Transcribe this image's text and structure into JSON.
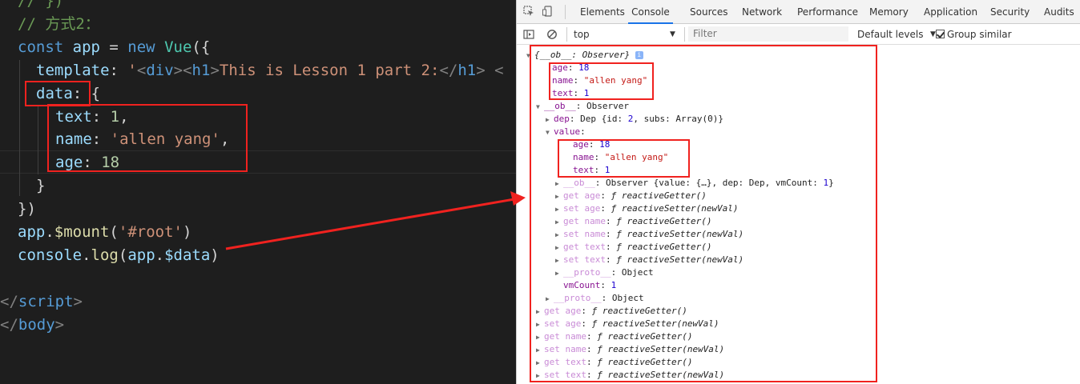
{
  "editor": {
    "lines": [
      {
        "parts": [
          [
            "// })",
            "com"
          ]
        ]
      },
      {
        "parts": [
          [
            "// 方式2：",
            "com"
          ]
        ]
      },
      {
        "parts": [
          [
            "const ",
            "kw"
          ],
          [
            "app",
            "var"
          ],
          [
            " = ",
            "pun"
          ],
          [
            "new ",
            "kw"
          ],
          [
            "Vue",
            "cls"
          ],
          [
            "({",
            "pun"
          ]
        ]
      },
      {
        "parts": [
          [
            "template",
            "var"
          ],
          [
            ": ",
            "pun"
          ],
          [
            "'",
            "str"
          ],
          [
            "<",
            "tag"
          ],
          [
            "div",
            "tagname"
          ],
          [
            ">",
            "tag"
          ],
          [
            "<",
            "tag"
          ],
          [
            "h1",
            "tagname"
          ],
          [
            ">",
            "tag"
          ],
          [
            "This is Lesson 1 part 2:",
            "str"
          ],
          [
            "</",
            "tag"
          ],
          [
            "h1",
            "tagname"
          ],
          [
            ">",
            "tag"
          ],
          [
            " <",
            "tag"
          ]
        ]
      },
      {
        "parts": [
          [
            "data",
            "var"
          ],
          [
            ": {",
            "pun"
          ]
        ]
      },
      {
        "parts": [
          [
            "text",
            "var"
          ],
          [
            ": ",
            "pun"
          ],
          [
            "1",
            "num"
          ],
          [
            ",",
            "pun"
          ]
        ]
      },
      {
        "parts": [
          [
            "name",
            "var"
          ],
          [
            ": ",
            "pun"
          ],
          [
            "'allen yang'",
            "str"
          ],
          [
            ",",
            "pun"
          ]
        ]
      },
      {
        "parts": [
          [
            "age",
            "var"
          ],
          [
            ": ",
            "pun"
          ],
          [
            "18",
            "num"
          ]
        ]
      },
      {
        "parts": [
          [
            "}",
            "pun"
          ]
        ]
      },
      {
        "parts": [
          [
            "})",
            "pun"
          ]
        ]
      },
      {
        "parts": [
          [
            "app",
            "var"
          ],
          [
            ".",
            "pun"
          ],
          [
            "$mount",
            "fn"
          ],
          [
            "(",
            "pun"
          ],
          [
            "'#root'",
            "str"
          ],
          [
            ")",
            "pun"
          ]
        ]
      },
      {
        "parts": [
          [
            "console",
            "var"
          ],
          [
            ".",
            "pun"
          ],
          [
            "log",
            "fn"
          ],
          [
            "(",
            "pun"
          ],
          [
            "app",
            "var"
          ],
          [
            ".",
            "pun"
          ],
          [
            "$data",
            "var"
          ],
          [
            ")",
            "pun"
          ]
        ]
      },
      {
        "parts": []
      },
      {
        "parts": [
          [
            "</",
            "tag"
          ],
          [
            "script",
            "tagname"
          ],
          [
            ">",
            "tag"
          ]
        ]
      },
      {
        "parts": [
          [
            "</",
            "tag"
          ],
          [
            "body",
            "tagname"
          ],
          [
            ">",
            "tag"
          ]
        ]
      }
    ]
  },
  "devtools": {
    "tabs": [
      "Elements",
      "Console",
      "Sources",
      "Network",
      "Performance",
      "Memory",
      "Application",
      "Security",
      "Audits"
    ],
    "active_tab": "Console",
    "context": "top",
    "filter_placeholder": "Filter",
    "levels": "Default levels",
    "group_similar": "Group similar",
    "accent_color": "#1a73e8"
  },
  "console": {
    "rows": [
      {
        "tri": "▼",
        "html": "<span class='i'>{__ob__: Observer}</span> <span class='info'>i</span>"
      },
      {
        "tri": "",
        "html": "<span class='k'>age</span>: <span class='n'>18</span>"
      },
      {
        "tri": "",
        "html": "<span class='k'>name</span>: <span class='s'>\"allen yang\"</span>"
      },
      {
        "tri": "",
        "html": "<span class='k'>text</span>: <span class='n'>1</span>"
      },
      {
        "tri": "▼",
        "html": "<span class='k'>__ob__</span>: Observer"
      },
      {
        "tri": "▶",
        "html": "<span class='k'>dep</span>: Dep {id: <span class='n'>2</span>, subs: Array(0)}"
      },
      {
        "tri": "▼",
        "html": "<span class='k'>value</span>:"
      },
      {
        "tri": "",
        "html": "<span class='k'>age</span>: <span class='n'>18</span>"
      },
      {
        "tri": "",
        "html": "<span class='k'>name</span>: <span class='s'>\"allen yang\"</span>"
      },
      {
        "tri": "",
        "html": "<span class='k'>text</span>: <span class='n'>1</span>"
      },
      {
        "tri": "▶",
        "html": "<span class='kd'>__ob__</span>: Observer {value: {…}, dep: Dep, vmCount: <span class='n'>1</span>}"
      },
      {
        "tri": "▶",
        "html": "<span class='kd'>get age</span>: <span class='i'>ƒ reactiveGetter()</span>"
      },
      {
        "tri": "▶",
        "html": "<span class='kd'>set age</span>: <span class='i'>ƒ reactiveSetter(newVal)</span>"
      },
      {
        "tri": "▶",
        "html": "<span class='kd'>get name</span>: <span class='i'>ƒ reactiveGetter()</span>"
      },
      {
        "tri": "▶",
        "html": "<span class='kd'>set name</span>: <span class='i'>ƒ reactiveSetter(newVal)</span>"
      },
      {
        "tri": "▶",
        "html": "<span class='kd'>get text</span>: <span class='i'>ƒ reactiveGetter()</span>"
      },
      {
        "tri": "▶",
        "html": "<span class='kd'>set text</span>: <span class='i'>ƒ reactiveSetter(newVal)</span>"
      },
      {
        "tri": "▶",
        "html": "<span class='kd'>__proto__</span>: Object"
      },
      {
        "tri": "",
        "html": "<span class='k'>vmCount</span>: <span class='n'>1</span>"
      },
      {
        "tri": "▶",
        "html": "<span class='kd'>__proto__</span>: Object"
      },
      {
        "tri": "▶",
        "html": "<span class='kd'>get age</span>: <span class='i'>ƒ reactiveGetter()</span>"
      },
      {
        "tri": "▶",
        "html": "<span class='kd'>set age</span>: <span class='i'>ƒ reactiveSetter(newVal)</span>"
      },
      {
        "tri": "▶",
        "html": "<span class='kd'>get name</span>: <span class='i'>ƒ reactiveGetter()</span>"
      },
      {
        "tri": "▶",
        "html": "<span class='kd'>set name</span>: <span class='i'>ƒ reactiveSetter(newVal)</span>"
      },
      {
        "tri": "▶",
        "html": "<span class='kd'>get text</span>: <span class='i'>ƒ reactiveGetter()</span>"
      },
      {
        "tri": "▶",
        "html": "<span class='kd'>set text</span>: <span class='i'>ƒ reactiveSetter(newVal)</span>"
      }
    ]
  },
  "annotation_color": "#f0221f"
}
